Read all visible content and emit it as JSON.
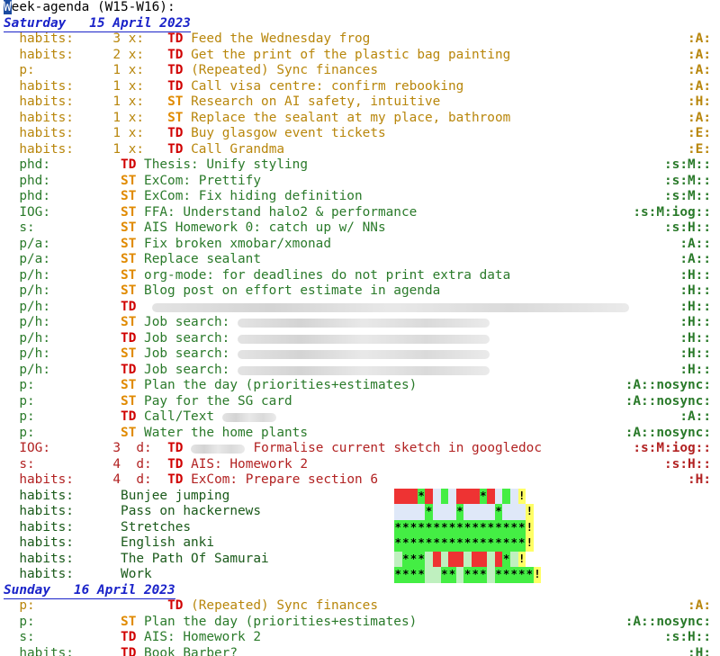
{
  "header": {
    "title_first": "W",
    "title_rest": "eek-agenda (W15-W16):"
  },
  "colors": {
    "todo": "#d00000",
    "started": "#e08a00",
    "date": "#1a23c9",
    "habit_red": "#ee3333",
    "habit_green": "#44ee44",
    "habit_blue": "#dfe8f8",
    "habit_lightgreen": "#bff0bf",
    "habit_yellow": "#ffff66",
    "habit_paleyellow": "#f6f6b0"
  },
  "days": [
    {
      "day": "Saturday",
      "date": "15 April 2023",
      "items": [
        {
          "cat": "habits:",
          "when": "3 x:",
          "kw": "TD",
          "text": "Feed the Wednesday frog",
          "tag": ":A:",
          "color": "gold"
        },
        {
          "cat": "habits:",
          "when": "2 x:",
          "kw": "TD",
          "text": "Get the print of the plastic bag painting",
          "tag": ":A:",
          "color": "gold"
        },
        {
          "cat": "p:",
          "when": "1 x:",
          "kw": "TD",
          "text": "(Repeated) Sync finances",
          "tag": ":A:",
          "color": "gold"
        },
        {
          "cat": "habits:",
          "when": "1 x:",
          "kw": "TD",
          "text": "Call visa centre: confirm rebooking",
          "tag": ":A:",
          "color": "gold"
        },
        {
          "cat": "habits:",
          "when": "1 x:",
          "kw": "ST",
          "text": "Research on AI safety, intuitive",
          "tag": ":H:",
          "color": "gold"
        },
        {
          "cat": "habits:",
          "when": "1 x:",
          "kw": "ST",
          "text": "Replace the sealant at my place, bathroom",
          "tag": ":A:",
          "color": "gold"
        },
        {
          "cat": "habits:",
          "when": "1 x:",
          "kw": "TD",
          "text": "Buy glasgow event tickets",
          "tag": ":E:",
          "color": "gold"
        },
        {
          "cat": "habits:",
          "when": "1 x:",
          "kw": "TD",
          "text": "Call Grandma",
          "tag": ":E:",
          "color": "gold"
        },
        {
          "cat": "phd:",
          "when": "",
          "kw": "TD",
          "text": "Thesis: Unify styling",
          "tag": ":s:M::",
          "color": "green"
        },
        {
          "cat": "phd:",
          "when": "",
          "kw": "ST",
          "text": "ExCom: Prettify",
          "tag": ":s:M::",
          "color": "green"
        },
        {
          "cat": "phd:",
          "when": "",
          "kw": "ST",
          "text": "ExCom: Fix hiding definition",
          "tag": ":s:M::",
          "color": "green"
        },
        {
          "cat": "IOG:",
          "when": "",
          "kw": "ST",
          "text": "FFA: Understand halo2 & performance",
          "tag": ":s:M:iog::",
          "color": "green"
        },
        {
          "cat": "s:",
          "when": "",
          "kw": "ST",
          "text": "AIS Homework 0: catch up w/ NNs",
          "tag": ":s:H::",
          "color": "green"
        },
        {
          "cat": "p/a:",
          "when": "",
          "kw": "ST",
          "text": "Fix broken xmobar/xmonad",
          "tag": ":A::",
          "color": "green"
        },
        {
          "cat": "p/a:",
          "when": "",
          "kw": "ST",
          "text": "Replace sealant",
          "tag": ":A::",
          "color": "green"
        },
        {
          "cat": "p/h:",
          "when": "",
          "kw": "ST",
          "text": "org-mode: for deadlines do not print extra data",
          "tag": ":H::",
          "color": "green"
        },
        {
          "cat": "p/h:",
          "when": "",
          "kw": "ST",
          "text": "Blog post on effort estimate in agenda",
          "tag": ":H::",
          "color": "green"
        },
        {
          "cat": "p/h:",
          "when": "",
          "kw": "TD",
          "text": "",
          "blur": true,
          "tag": ":H::",
          "color": "green"
        },
        {
          "cat": "p/h:",
          "when": "",
          "kw": "ST",
          "text": "Job search:",
          "blur": true,
          "tag": ":H::",
          "color": "green"
        },
        {
          "cat": "p/h:",
          "when": "",
          "kw": "TD",
          "text": "Job search:",
          "blur": true,
          "tag": ":H::",
          "color": "green"
        },
        {
          "cat": "p/h:",
          "when": "",
          "kw": "ST",
          "text": "Job search:",
          "blur": true,
          "tag": ":H::",
          "color": "green"
        },
        {
          "cat": "p/h:",
          "when": "",
          "kw": "TD",
          "text": "Job search:",
          "blur": true,
          "tag": ":H::",
          "color": "green"
        },
        {
          "cat": "p:",
          "when": "",
          "kw": "ST",
          "text": "Plan the day (priorities+estimates)",
          "tag": ":A::nosync:",
          "color": "green"
        },
        {
          "cat": "p:",
          "when": "",
          "kw": "ST",
          "text": "Pay for the SG card",
          "tag": ":A::nosync:",
          "color": "green"
        },
        {
          "cat": "p:",
          "when": "",
          "kw": "TD",
          "text": "Call/Text",
          "blur": true,
          "tag": ":A::",
          "color": "green"
        },
        {
          "cat": "p:",
          "when": "",
          "kw": "ST",
          "text": "Water the home plants",
          "tag": ":A::nosync:",
          "color": "green"
        },
        {
          "cat": "IOG:",
          "when": "3  d:",
          "kw": "TD",
          "text": "Formalise current sketch in googledoc",
          "blur": true,
          "tag": ":s:M:iog::",
          "color": "red"
        },
        {
          "cat": "s:",
          "when": "4  d:",
          "kw": "TD",
          "text": "AIS: Homework 2",
          "tag": ":s:H::",
          "color": "red"
        },
        {
          "cat": "habits:",
          "when": "4  d:",
          "kw": "TD",
          "text": "ExCom: Prepare section 6",
          "tag": ":H:",
          "color": "red"
        },
        {
          "cat": "habits:",
          "when": "",
          "kw": "",
          "text": "Bunjee jumping",
          "tag": "",
          "color": "dark",
          "graph": "RRR*RbGbRRR*RbGb!"
        },
        {
          "cat": "habits:",
          "when": "",
          "kw": "",
          "text": "Pass on hackernews",
          "tag": "",
          "color": "dark",
          "graph": "bbbb*bbb*bbbb*bbb!"
        },
        {
          "cat": "habits:",
          "when": "",
          "kw": "",
          "text": "Stretches",
          "tag": "",
          "color": "dark",
          "graph": "*****************!"
        },
        {
          "cat": "habits:",
          "when": "",
          "kw": "",
          "text": "English anki",
          "tag": "",
          "color": "dark",
          "graph": "*****************!"
        },
        {
          "cat": "habits:",
          "when": "",
          "kw": "",
          "text": "The Path Of Samurai",
          "tag": "",
          "color": "dark",
          "graph": "g***gRgRRgRRgR*g!"
        },
        {
          "cat": "habits:",
          "when": "",
          "kw": "",
          "text": "Work",
          "tag": "",
          "color": "dark",
          "graph": "****gg**g***g*****!"
        }
      ]
    },
    {
      "day": "Sunday",
      "date": "16 April 2023",
      "items": [
        {
          "cat": "p:",
          "when": "",
          "kw": "TD",
          "text": "(Repeated) Sync finances",
          "tag": ":A:",
          "color": "gold"
        },
        {
          "cat": "p:",
          "when": "",
          "kw": "ST",
          "text": "Plan the day (priorities+estimates)",
          "tag": ":A::nosync:",
          "color": "green"
        },
        {
          "cat": "s:",
          "when": "",
          "kw": "TD",
          "text": "AIS: Homework 2",
          "tag": ":s:H::",
          "color": "green"
        },
        {
          "cat": "habits:",
          "when": "",
          "kw": "TD",
          "text": "Book Barber?",
          "tag": ":H:",
          "color": "green"
        }
      ]
    }
  ]
}
